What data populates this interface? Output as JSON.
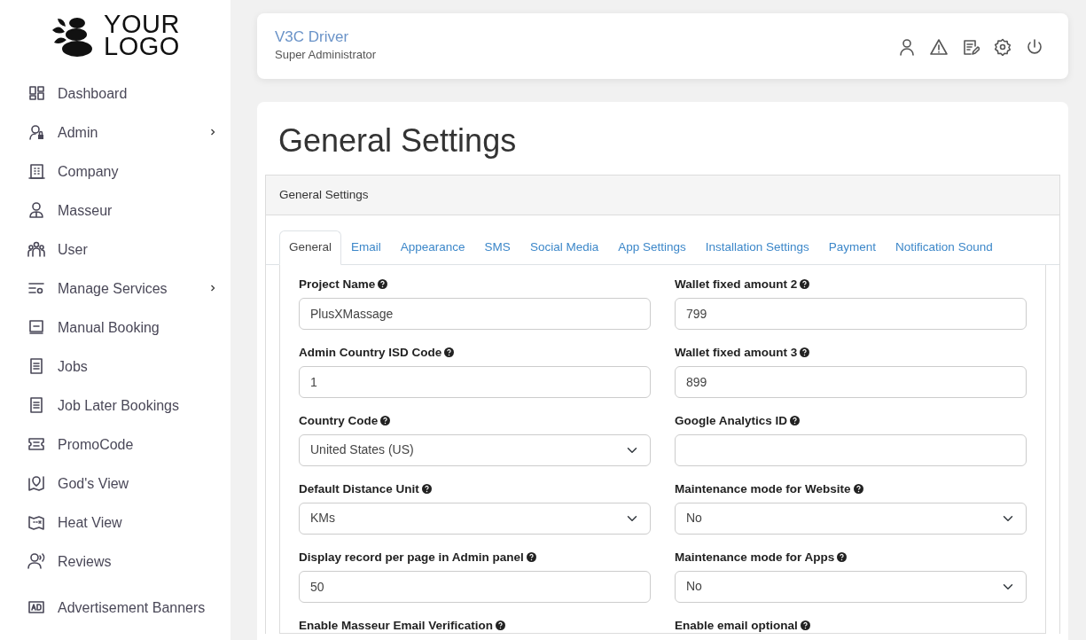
{
  "logo": {
    "line1": "YOUR",
    "line2": "LOGO"
  },
  "sidebar": {
    "items": [
      {
        "label": "Dashboard",
        "submenu": false
      },
      {
        "label": "Admin",
        "submenu": true
      },
      {
        "label": "Company",
        "submenu": false
      },
      {
        "label": "Masseur",
        "submenu": false
      },
      {
        "label": "User",
        "submenu": false
      },
      {
        "label": "Manage Services",
        "submenu": true
      },
      {
        "label": "Manual Booking",
        "submenu": false
      },
      {
        "label": "Jobs",
        "submenu": false
      },
      {
        "label": "Job Later Bookings",
        "submenu": false
      },
      {
        "label": "PromoCode",
        "submenu": false
      },
      {
        "label": "God's View",
        "submenu": false
      },
      {
        "label": "Heat View",
        "submenu": false
      },
      {
        "label": "Reviews",
        "submenu": false
      },
      {
        "label": "Advertisement Banners",
        "submenu": false
      }
    ]
  },
  "header": {
    "name": "V3C Driver",
    "role": "Super Administrator"
  },
  "page": {
    "title": "General Settings",
    "panel_title": "General Settings"
  },
  "tabs": [
    {
      "label": "General",
      "selected": true
    },
    {
      "label": "Email",
      "selected": false
    },
    {
      "label": "Appearance",
      "selected": false
    },
    {
      "label": "SMS",
      "selected": false
    },
    {
      "label": "Social Media",
      "selected": false
    },
    {
      "label": "App Settings",
      "selected": false
    },
    {
      "label": "Installation Settings",
      "selected": false
    },
    {
      "label": "Payment",
      "selected": false
    },
    {
      "label": "Notification Sound",
      "selected": false
    }
  ],
  "form": {
    "left": [
      {
        "label": "Project Name",
        "kind": "text",
        "value": "PlusXMassage"
      },
      {
        "label": "Admin Country ISD Code",
        "kind": "number",
        "value": "1"
      },
      {
        "label": "Country Code",
        "kind": "select",
        "value": "United States (US)"
      },
      {
        "label": "Default Distance Unit",
        "kind": "select",
        "value": "KMs"
      },
      {
        "label": "Display record per page in Admin panel",
        "kind": "number",
        "value": "50"
      },
      {
        "label": "Enable Masseur Email Verification"
      }
    ],
    "right": [
      {
        "label": "Wallet fixed amount 2",
        "kind": "number",
        "value": "799"
      },
      {
        "label": "Wallet fixed amount 3",
        "kind": "number",
        "value": "899"
      },
      {
        "label": "Google Analytics ID",
        "kind": "text"
      },
      {
        "label": "Maintenance mode for Website",
        "kind": "select",
        "value": "No"
      },
      {
        "label": "Maintenance mode for Apps",
        "kind": "select",
        "value": "No"
      },
      {
        "label": "Enable email optional"
      }
    ]
  }
}
